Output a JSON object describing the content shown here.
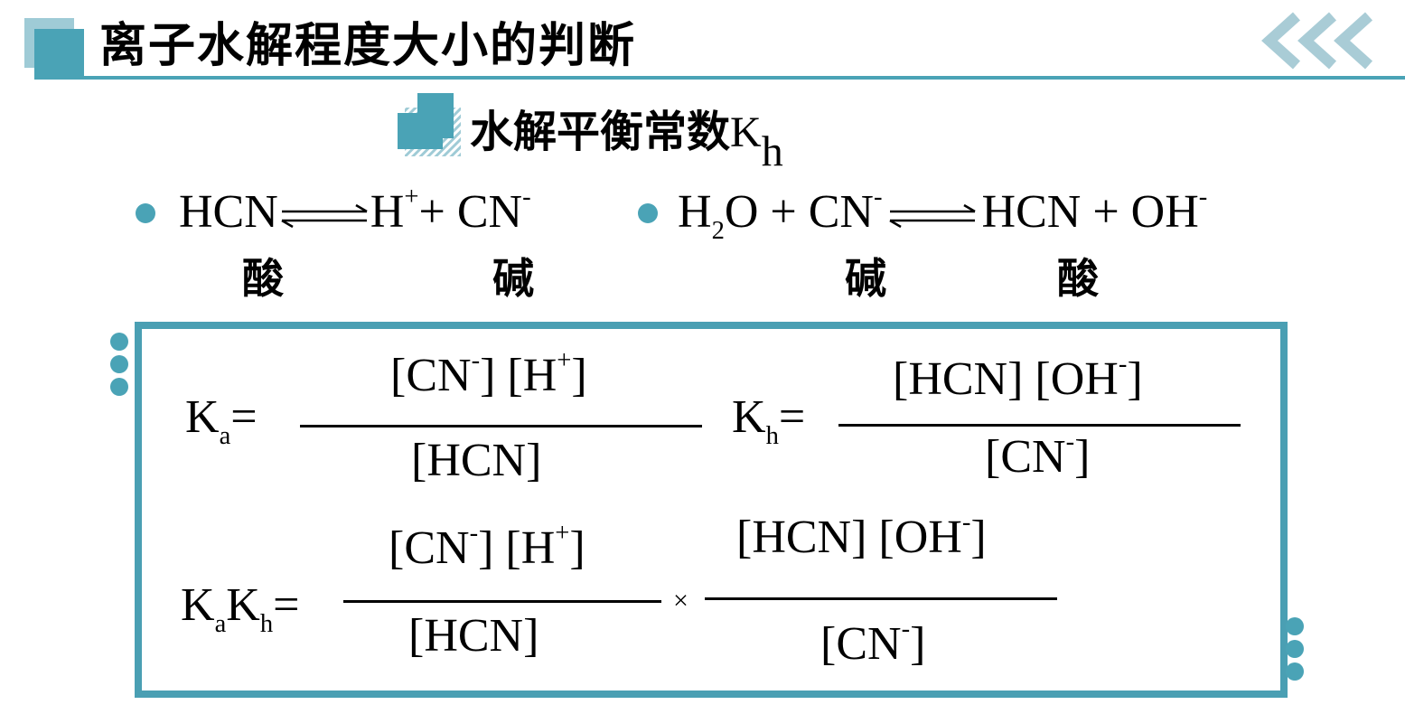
{
  "header": {
    "title": "离子水解程度大小的判断"
  },
  "section": {
    "subtitle_text": "水解平衡常数",
    "subtitle_symbol": "K",
    "subtitle_subscript": "h"
  },
  "reaction1": {
    "reactant": "HCN",
    "product_h": "H",
    "product_h_charge": "+",
    "plus": "+",
    "product_cn": "CN",
    "product_cn_charge": "-",
    "label_acid": "酸",
    "label_base": "碱"
  },
  "reaction2": {
    "h2o_h": "H",
    "h2o_sub": "2",
    "h2o_o": "O",
    "plus1": "+",
    "cn": "CN",
    "cn_charge": "-",
    "hcn": "HCN",
    "plus2": "+",
    "oh": "OH",
    "oh_charge": "-",
    "label_base": "碱",
    "label_acid": "酸"
  },
  "formulas": {
    "ka_symbol": "K",
    "ka_sub": "a",
    "equals": "=",
    "ka_num_cn": "[CN",
    "ka_num_cn_charge": "-",
    "ka_num_h": "] [H",
    "ka_num_h_charge": "+",
    "ka_num_close": "]",
    "ka_den": "[HCN]",
    "kh_symbol": "K",
    "kh_sub": "h",
    "kh_num_hcn": "[HCN] [OH",
    "kh_num_charge": "-",
    "kh_num_close": "]",
    "kh_den_open": "[CN",
    "kh_den_charge": "-",
    "kh_den_close": "]",
    "kakh_k1": "K",
    "kakh_sub1": "a",
    "kakh_k2": "K",
    "kakh_sub2": "h",
    "times": "×",
    "p1_num_cn": "[CN",
    "p1_num_cn_charge": "-",
    "p1_num_h": "] [H",
    "p1_num_h_charge": "+",
    "p1_num_close": "]",
    "p1_den": "[HCN]",
    "p2_num_hcn": "[HCN] [OH",
    "p2_num_charge": "-",
    "p2_num_close": "]",
    "p2_den_open": "[CN",
    "p2_den_charge": "-",
    "p2_den_close": "]"
  },
  "colors": {
    "accent": "#4aa3b6",
    "accent_light": "#9fcbd6",
    "frame": "#4a9fb3"
  }
}
